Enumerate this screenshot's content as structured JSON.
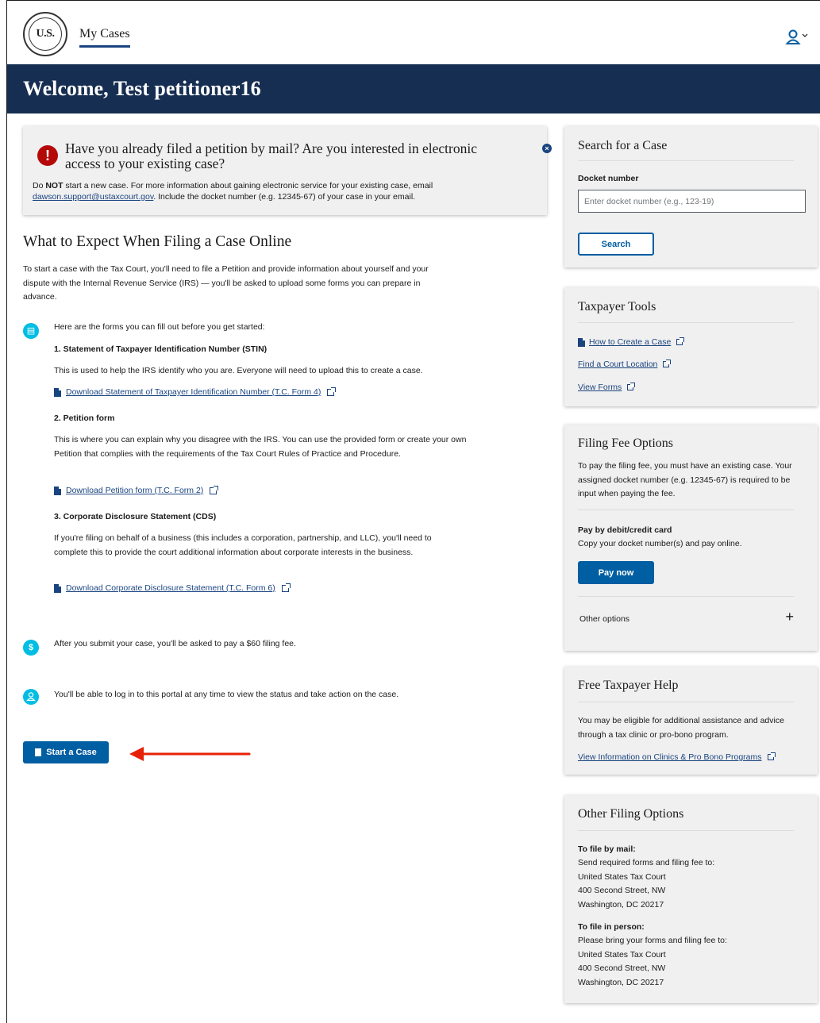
{
  "header": {
    "seal_text": "U.S.",
    "nav_label": "My Cases",
    "user_icon": "user-icon"
  },
  "banner": {
    "title": "Welcome, Test petitioner16"
  },
  "alert": {
    "heading": "Have you already filed a petition by mail? Are you interested in electronic access to your existing case?",
    "body_prefix": "Do ",
    "body_strong": "NOT",
    "body_mid": " start a new case. For more information about gaining electronic service for your existing case, email ",
    "email": "dawson.support@ustaxcourt.gov",
    "body_suffix": ". Include the docket number (e.g. 12345-67) of your case in your email.",
    "close_icon": "close-icon"
  },
  "main": {
    "title": "What to Expect When Filing a Case Online",
    "intro": "To start a case with the Tax Court, you'll need to file a Petition and provide information about yourself and your dispute with the Internal Revenue Service (IRS) — you'll be asked to upload some forms you can prepare in advance.",
    "forms_intro": "Here are the forms you can fill out before you get started:",
    "forms": [
      {
        "title": "1. Statement of Taxpayer Identification Number (STIN)",
        "desc": "This is used to help the IRS identify who you are. Everyone will need to upload this to create a case.",
        "link": "Download Statement of Taxpayer Identification Number (T.C. Form 4)"
      },
      {
        "title": "2. Petition form",
        "desc": "This is where you can explain why you disagree with the IRS. You can use the provided form or create your own Petition that complies with the requirements of the Tax Court Rules of Practice and Procedure.",
        "link": "Download Petition form (T.C. Form 2)"
      },
      {
        "title": "3. Corporate Disclosure Statement (CDS)",
        "desc": "If you're filing on behalf of a business (this includes a corporation, partnership, and LLC), you'll need to complete this to provide the court additional information about corporate interests in the business.",
        "link": "Download Corporate Disclosure Statement (T.C. Form 6)"
      }
    ],
    "fee_note": "After you submit your case, you'll be asked to pay a $60 filing fee.",
    "portal_note": "You'll be able to log in to this portal at any time to view the status and take action on the case.",
    "start_button": "Start a Case"
  },
  "sidebar": {
    "search": {
      "title": "Search for a Case",
      "label": "Docket number",
      "placeholder": "Enter docket number (e.g., 123-19)",
      "button": "Search"
    },
    "tools": {
      "title": "Taxpayer Tools",
      "links": [
        "How to Create a Case",
        "Find a Court Location",
        "View Forms"
      ]
    },
    "fees": {
      "title": "Filing Fee Options",
      "desc": "To pay the filing fee, you must have an existing case. Your assigned docket number (e.g. 12345-67) is required to be input when paying the fee.",
      "pay_label": "Pay by debit/credit card",
      "pay_desc": "Copy your docket number(s) and pay online.",
      "pay_button": "Pay now",
      "other": "Other options",
      "other_toggle": "+"
    },
    "help": {
      "title": "Free Taxpayer Help",
      "desc": "You may be eligible for additional assistance and advice through a tax clinic or pro-bono program.",
      "link": "View Information on Clinics & Pro Bono Programs"
    },
    "other_filing": {
      "title": "Other Filing Options",
      "mail_label": "To file by mail:",
      "mail_lines": [
        "Send required forms and filing fee to:",
        "United States Tax Court",
        "400 Second Street, NW",
        "Washington, DC 20217"
      ],
      "person_label": "To file in person:",
      "person_lines": [
        "Please bring your forms and filing fee to:",
        "United States Tax Court",
        "400 Second Street, NW",
        "Washington, DC 20217"
      ]
    }
  },
  "colors": {
    "banner": "#162e51",
    "primary": "#005ea2",
    "link": "#1a4480",
    "info_icon": "#00bde3",
    "error": "#b50909",
    "annotation_arrow": "#e52207"
  }
}
